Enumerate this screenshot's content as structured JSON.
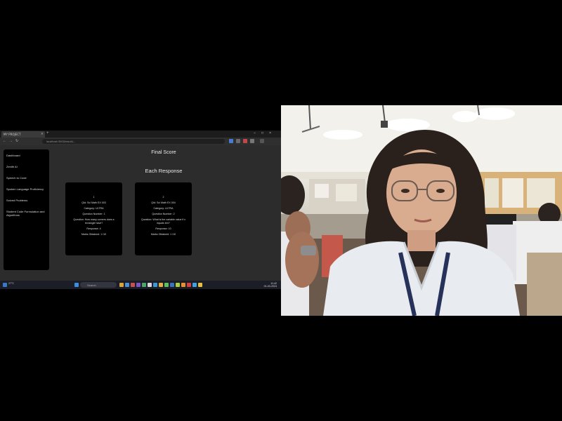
{
  "browser": {
    "tab_title": "MY PROJECT",
    "url": "localhost:3000/result/..."
  },
  "sidebar": {
    "items": [
      {
        "label": "Dashboard"
      },
      {
        "label": "Zenith AI"
      },
      {
        "label": "Speech to Code"
      },
      {
        "label": "Spoken Language Proficiency"
      },
      {
        "label": "Solved Problems"
      },
      {
        "label": "Student Code Formulation and Algorithms"
      }
    ]
  },
  "main": {
    "final_score_title": "Final Score",
    "each_response_title": "Each Response",
    "cards": [
      {
        "index": "1",
        "qid": "QId: Sci Math EX 003",
        "category": "Category: ULTRA",
        "question_number": "Question Number: 1",
        "question": "Question: How many corners does a rectangle have?",
        "response": "Response: 4",
        "marks": "Marks Obtained: 1 /10"
      },
      {
        "index": "2",
        "qid": "QId: Sci Math EX 004",
        "category": "Category: ULTRA",
        "question_number": "Question Number: 2",
        "question": "Question: What is the variable value if x equals ten?",
        "response": "Response: 10",
        "marks": "Marks Obtained: 1 /10"
      }
    ]
  },
  "taskbar": {
    "search": "Search",
    "weather": "27°C",
    "time": "11:42",
    "date": "01-03-2024"
  },
  "colors": {
    "page_bg": "#2c2c2c",
    "panel_bg": "#000000",
    "text": "#e8e8e8"
  }
}
